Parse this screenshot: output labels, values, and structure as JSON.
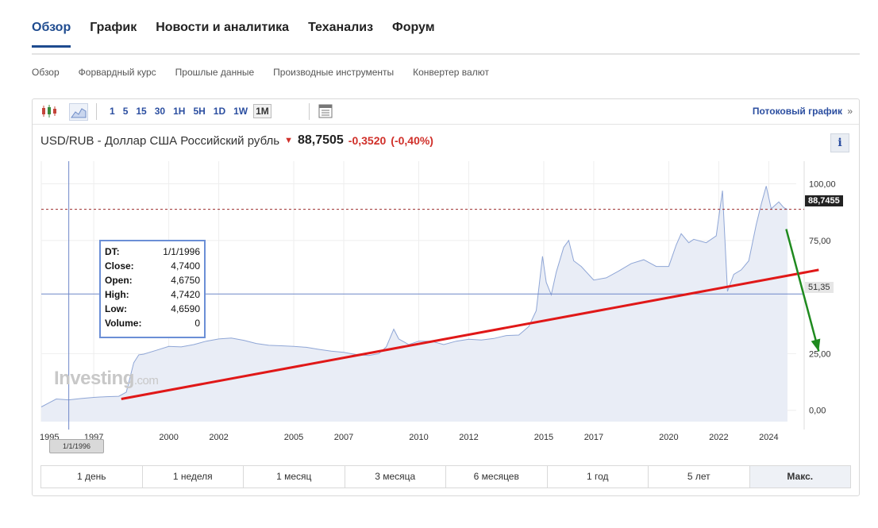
{
  "tabs": [
    {
      "label": "Обзор",
      "active": true
    },
    {
      "label": "График"
    },
    {
      "label": "Новости и аналитика"
    },
    {
      "label": "Теханализ"
    },
    {
      "label": "Форум"
    }
  ],
  "subnav": [
    "Обзор",
    "Форвардный курс",
    "Прошлые данные",
    "Производные инструменты",
    "Конвертер валют"
  ],
  "toolbar": {
    "intervals": [
      "1",
      "5",
      "15",
      "30",
      "1H",
      "5H",
      "1D",
      "1W",
      "1M"
    ],
    "active_interval": "1M",
    "stream_label": "Потоковый график",
    "stream_glyph": "»",
    "icons": [
      "candlestick-icon",
      "area-chart-icon",
      "table-icon"
    ]
  },
  "quote": {
    "name": "USD/RUB - Доллар США Российский рубль",
    "direction_glyph": "🡇",
    "price": "88,7505",
    "change": "-0,3520",
    "change_pct": "(-0,40%)",
    "down_color": "#d0302a"
  },
  "info_label": "i",
  "ranges": [
    {
      "label": "1 день"
    },
    {
      "label": "1 неделя"
    },
    {
      "label": "1 месяц"
    },
    {
      "label": "3 месяца"
    },
    {
      "label": "6 месяцев"
    },
    {
      "label": "1 год"
    },
    {
      "label": "5 лет"
    },
    {
      "label": "Макс.",
      "active": true
    }
  ],
  "tooltip": {
    "rows": [
      {
        "k": "DT:",
        "v": "1/1/1996"
      },
      {
        "k": "Close:",
        "v": "4,7400"
      },
      {
        "k": "Open:",
        "v": "4,6750"
      },
      {
        "k": "High:",
        "v": "4,7420"
      },
      {
        "k": "Low:",
        "v": "4,6590"
      },
      {
        "k": "Volume:",
        "v": "0"
      }
    ]
  },
  "watermark": {
    "main": "Investing",
    "suffix": ".com"
  },
  "crosshair_date": "1/1/1996",
  "price_tag": "88,7455",
  "crosshair_value": "51,35",
  "chart_data": {
    "type": "area",
    "series_color": "#8fa6d6",
    "fill_color": "#e9edf6",
    "ylim": [
      -5,
      110
    ],
    "yticks": [
      {
        "v": 100,
        "label": "100,00"
      },
      {
        "v": 75,
        "label": "75,00"
      },
      {
        "v": 25,
        "label": "25,00"
      },
      {
        "v": 0,
        "label": "0,00"
      }
    ],
    "xlim": [
      1994.9,
      2025.1
    ],
    "xticks": [
      {
        "v": 1994.9,
        "label": "1995"
      },
      {
        "v": 1997,
        "label": "1997"
      },
      {
        "v": 2000,
        "label": "2000"
      },
      {
        "v": 2002,
        "label": "2002"
      },
      {
        "v": 2005,
        "label": "2005"
      },
      {
        "v": 2007,
        "label": "2007"
      },
      {
        "v": 2010,
        "label": "2010"
      },
      {
        "v": 2012,
        "label": "2012"
      },
      {
        "v": 2015,
        "label": "2015"
      },
      {
        "v": 2017,
        "label": "2017"
      },
      {
        "v": 2020,
        "label": "2020"
      },
      {
        "v": 2022,
        "label": "2022"
      },
      {
        "v": 2024,
        "label": "2024"
      }
    ],
    "x": [
      1994.9,
      1995.5,
      1996.0,
      1996.5,
      1997.0,
      1997.5,
      1998.0,
      1998.3,
      1998.6,
      1998.8,
      1999.0,
      1999.5,
      2000.0,
      2000.5,
      2001.0,
      2001.5,
      2002.0,
      2002.5,
      2003.0,
      2003.5,
      2004.0,
      2004.5,
      2005.0,
      2005.5,
      2006.0,
      2006.5,
      2007.0,
      2007.5,
      2008.0,
      2008.4,
      2008.7,
      2009.0,
      2009.2,
      2009.6,
      2010.0,
      2010.5,
      2011.0,
      2011.5,
      2012.0,
      2012.5,
      2013.0,
      2013.5,
      2014.0,
      2014.4,
      2014.7,
      2014.95,
      2015.1,
      2015.3,
      2015.5,
      2015.8,
      2016.0,
      2016.2,
      2016.5,
      2017.0,
      2017.5,
      2018.0,
      2018.5,
      2019.0,
      2019.5,
      2020.0,
      2020.3,
      2020.5,
      2020.8,
      2021.0,
      2021.5,
      2021.9,
      2022.15,
      2022.35,
      2022.6,
      2022.9,
      2023.2,
      2023.5,
      2023.7,
      2023.9,
      2024.1,
      2024.4,
      2024.6,
      2024.75
    ],
    "y": [
      1.5,
      5.0,
      4.6,
      5.2,
      5.7,
      6.0,
      6.2,
      8.0,
      21.0,
      24.5,
      24.8,
      26.5,
      28.2,
      28.0,
      29.0,
      30.5,
      31.5,
      31.9,
      30.9,
      29.5,
      28.7,
      28.5,
      28.2,
      27.8,
      26.9,
      26.1,
      25.6,
      24.6,
      24.2,
      25.0,
      28.0,
      35.8,
      31.5,
      29.0,
      30.5,
      30.5,
      29.0,
      30.5,
      31.4,
      31.0,
      31.7,
      33.0,
      33.2,
      37.0,
      44.0,
      68.0,
      56.5,
      51.0,
      61.0,
      72.0,
      75.0,
      66.0,
      63.5,
      57.5,
      58.5,
      61.5,
      64.8,
      66.5,
      63.5,
      63.5,
      73.0,
      78.0,
      74.0,
      75.5,
      74.0,
      77.0,
      97.0,
      52.5,
      60.0,
      62.0,
      66.0,
      82.0,
      91.0,
      99.0,
      89.0,
      92.0,
      89.5,
      88.7
    ],
    "current_price": 88.7455,
    "crosshair_value": 51.35,
    "crosshair_x": 1996.0,
    "trendline_red": {
      "x": [
        1998.1,
        2026.0
      ],
      "y": [
        5.0,
        62.0
      ]
    },
    "arrow_green": {
      "x": [
        2024.7,
        2026.0
      ],
      "y": [
        80.0,
        26.0
      ]
    }
  }
}
